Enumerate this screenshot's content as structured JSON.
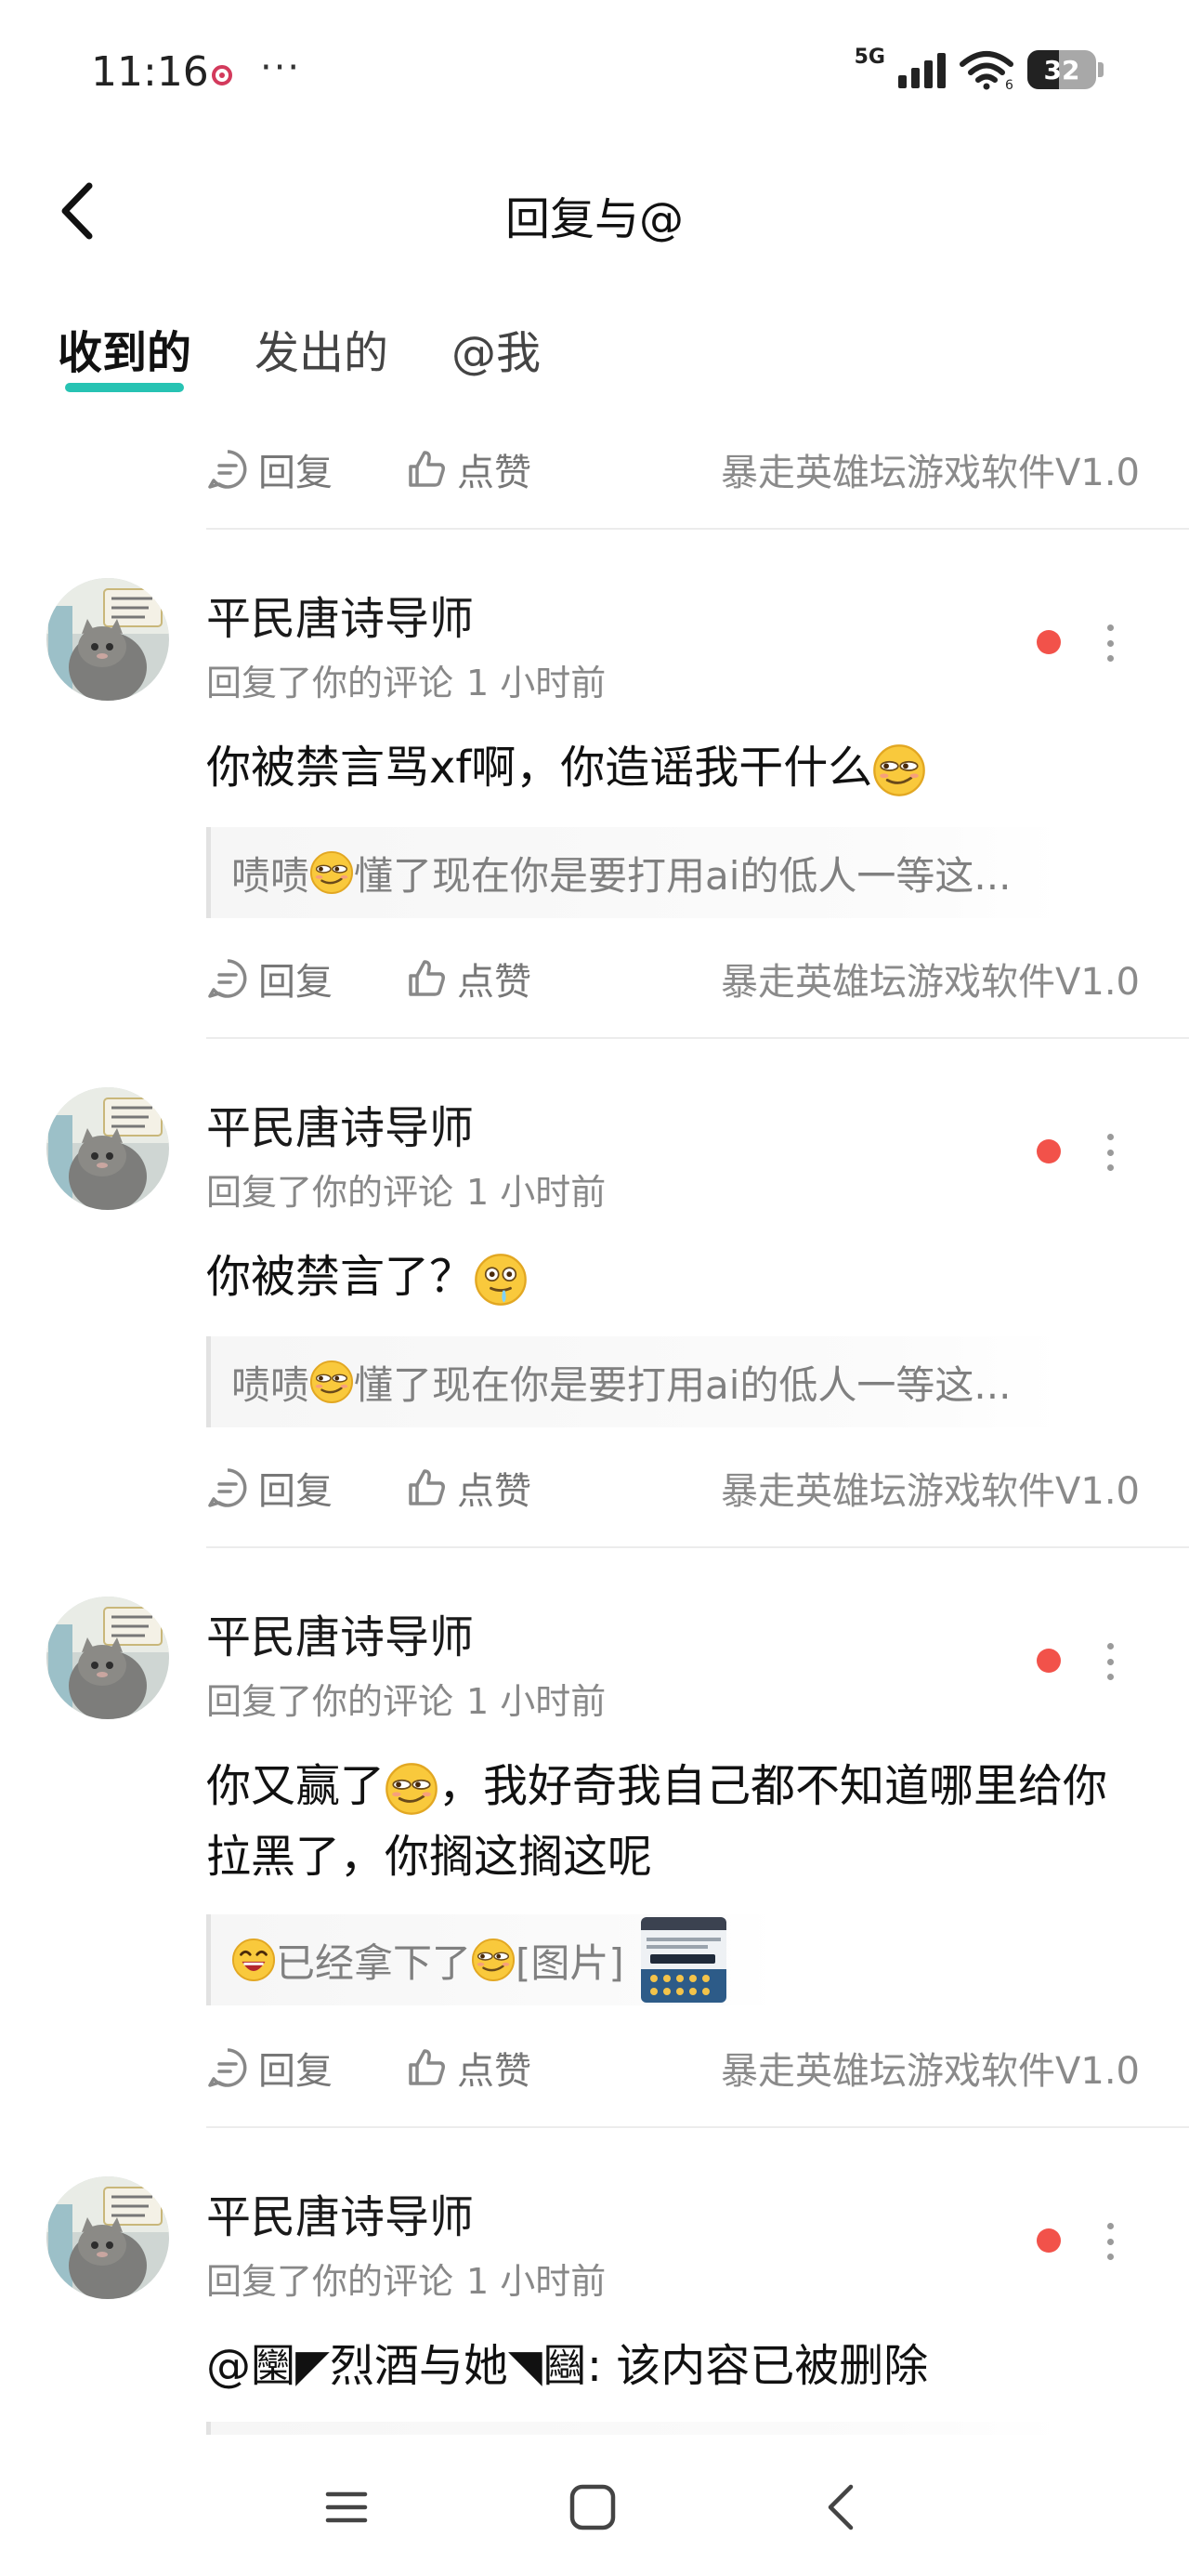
{
  "status_bar": {
    "time": "11:16",
    "more": "···",
    "network": "5G",
    "wifi_sub": "6",
    "battery": "32"
  },
  "header": {
    "title": "回复与@"
  },
  "tabs": [
    {
      "label": "收到的",
      "active": true
    },
    {
      "label": "发出的",
      "active": false
    },
    {
      "label": "@我",
      "active": false
    }
  ],
  "actions": {
    "reply_label": "回复",
    "like_label": "点赞"
  },
  "source_label": "暴走英雄坛游戏软件V1.0",
  "comments": [
    {
      "author": "平民唐诗导师",
      "meta": "回复了你的评论",
      "time": "1 小时前",
      "body": "你被禁言骂xf啊，你造谣我干什么",
      "body_emoji": "smirk-emoji",
      "quote_a": "啧啧",
      "quote_b": "懂了现在你是要打用ai的低人一等这..."
    },
    {
      "author": "平民唐诗导师",
      "meta": "回复了你的评论",
      "time": "1 小时前",
      "body": "你被禁言了？",
      "body_emoji": "drool-emoji",
      "quote_a": "啧啧",
      "quote_b": "懂了现在你是要打用ai的低人一等这..."
    },
    {
      "author": "平民唐诗导师",
      "meta": "回复了你的评论",
      "time": "1 小时前",
      "body_a": "你又赢了",
      "body_b": "，我好奇我自己都不知道哪里给你拉黑了，你搁这搁这呢",
      "quote_a": "已经拿下了",
      "quote_b": "[图片]"
    },
    {
      "author": "平民唐诗导师",
      "meta": "回复了你的评论",
      "time": "1 小时前",
      "body": "@圞◤烈酒与她◥圝: 该内容已被删除"
    }
  ]
}
